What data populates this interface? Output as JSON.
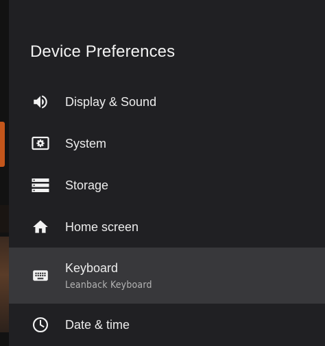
{
  "panel": {
    "title": "Device Preferences"
  },
  "menu": {
    "items": [
      {
        "label": "Display & Sound",
        "icon": "speaker-icon"
      },
      {
        "label": "System",
        "icon": "system-settings-icon"
      },
      {
        "label": "Storage",
        "icon": "storage-icon"
      },
      {
        "label": "Home screen",
        "icon": "home-icon"
      },
      {
        "label": "Keyboard",
        "sublabel": "Leanback Keyboard",
        "icon": "keyboard-icon",
        "selected": true
      },
      {
        "label": "Date & time",
        "icon": "clock-icon"
      }
    ]
  },
  "colors": {
    "panel_bg": "#202023",
    "selected_bg": "#38383b",
    "text_primary": "#ececec",
    "text_secondary": "#b4b4b4",
    "accent": "#c4561b"
  }
}
